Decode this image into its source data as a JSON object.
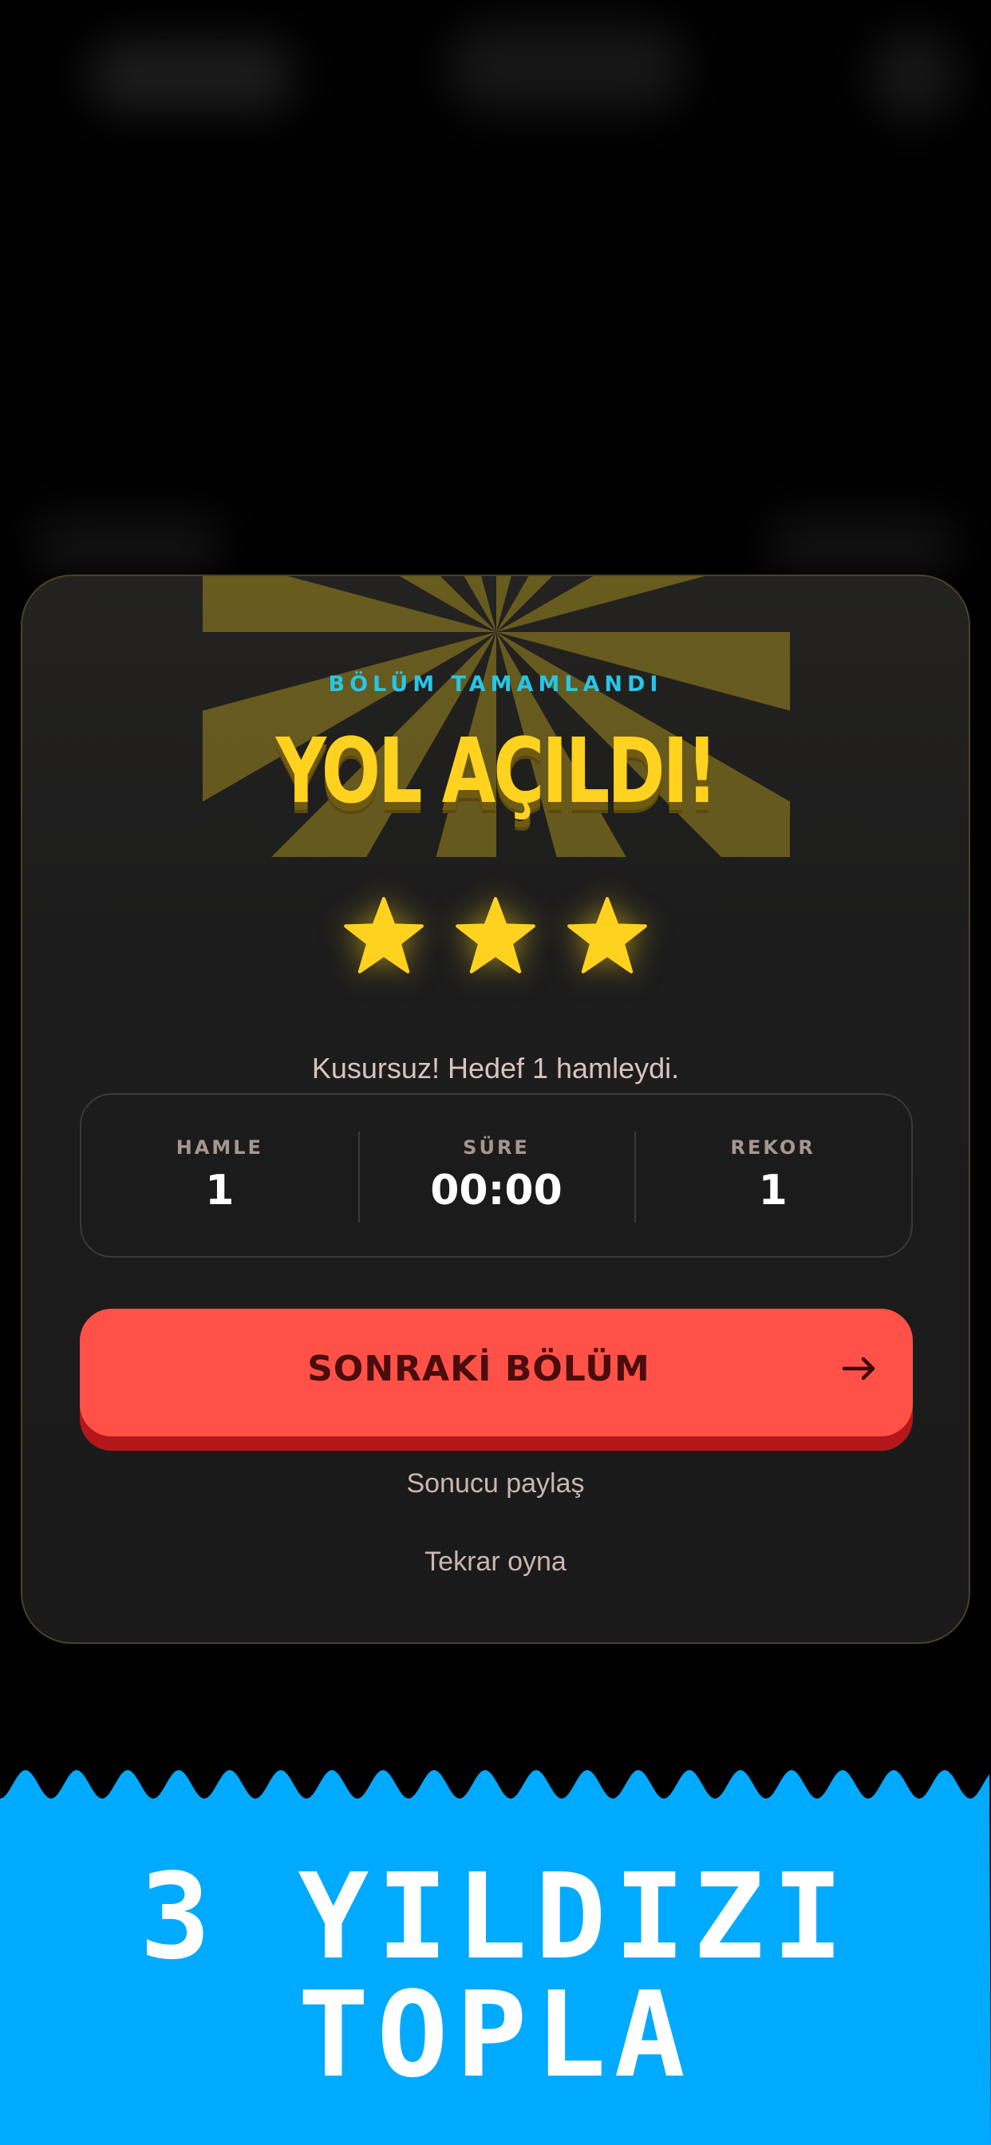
{
  "modal": {
    "eyebrow": "BÖLÜM TAMAMLANDI",
    "headline": "YOL AÇILDI!",
    "stars": {
      "earned": 3,
      "total": 3
    },
    "message": "Kusursuz! Hedef 1 hamleydi.",
    "stats": [
      {
        "label": "HAMLE",
        "value": "1"
      },
      {
        "label": "SÜRE",
        "value": "00:00"
      },
      {
        "label": "REKOR",
        "value": "1"
      }
    ],
    "primary_button": {
      "label": "SONRAKİ BÖLÜM",
      "icon": "arrow-right-icon"
    },
    "share_link": "Sonucu paylaş",
    "replay_link": "Tekrar oyna"
  },
  "promo": {
    "line1": "3 YILDIZI",
    "line2": "TOPLA"
  },
  "colors": {
    "background": "#000000",
    "card": "#1c1c1c",
    "accent_yellow": "#ffd21f",
    "accent_cyan": "#27c6e6",
    "button_red": "#ff5148",
    "button_shadow": "#b3171a",
    "banner_blue": "#00aaff"
  }
}
